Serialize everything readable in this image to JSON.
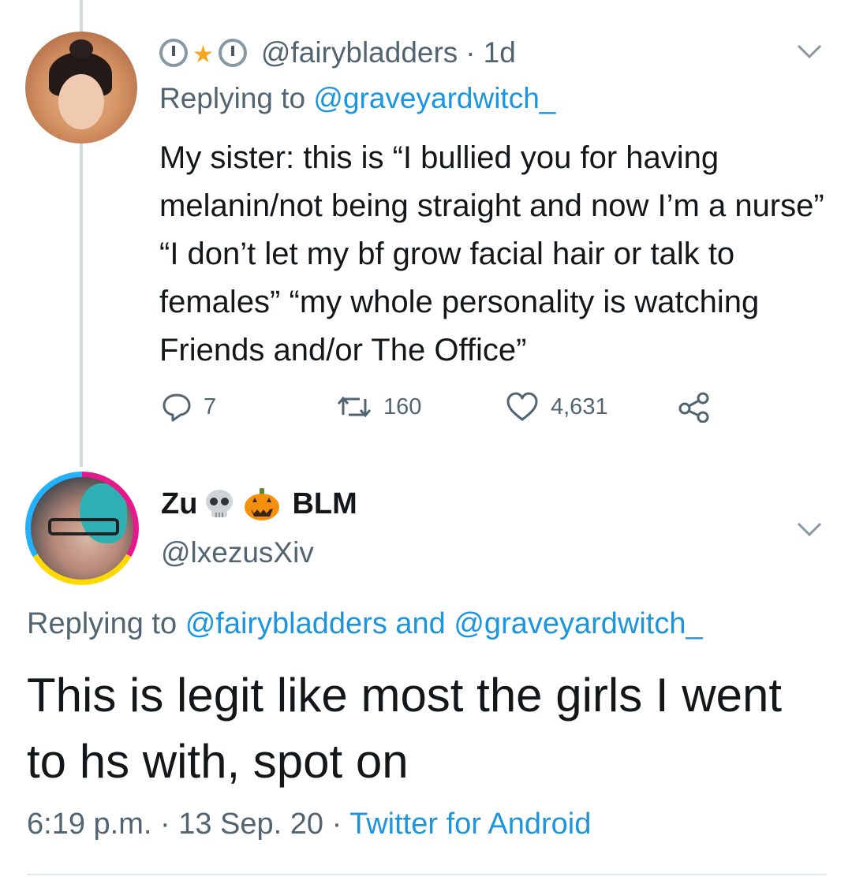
{
  "tweet1": {
    "author_emojis": [
      "clock-icon",
      "star-icon",
      "clock-icon"
    ],
    "handle": "@fairybladders",
    "separator": "·",
    "time": "1d",
    "replying_prefix": "Replying to",
    "replying_to": "@graveyardwitch_",
    "body": "My sister: this is “I bullied you for having melanin/not being straight and now I’m a nurse” “I don’t let my bf grow facial hair or talk to females” “my whole personality is watching Friends and/or The Office”",
    "actions": {
      "replies": "7",
      "retweets": "160",
      "likes": "4,631"
    }
  },
  "tweet2": {
    "name_first": "Zu",
    "name_last": "BLM",
    "name_emojis": [
      "skull-icon",
      "jack-o-lantern-icon"
    ],
    "handle": "@lxezusXiv",
    "replying_prefix": "Replying to",
    "replying_to_1": "@fairybladders",
    "replying_and": "and",
    "replying_to_2": "@graveyardwitch_",
    "body": "This is legit like most the girls I went to hs with, spot on",
    "time": "6:19 p.m.",
    "separator": "·",
    "date": "13 Sep. 20",
    "client": "Twitter for Android"
  },
  "colors": {
    "text": "#14171a",
    "secondary": "#536471",
    "link": "#1b95e0",
    "thread_line": "#cfd9de"
  }
}
